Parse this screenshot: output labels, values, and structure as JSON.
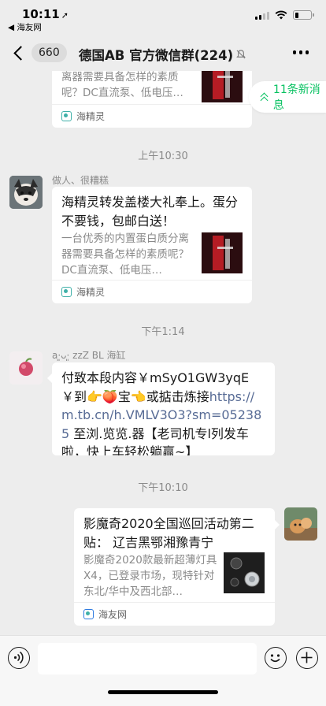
{
  "status_bar": {
    "time": "10:11",
    "back_app": "◀ 海友网"
  },
  "nav": {
    "unread_count": "660",
    "title": "德国AB  官方微信群(224)"
  },
  "new_messages": "11条新消息",
  "messages": [
    {
      "type": "card",
      "title": "",
      "desc": "离器需要具备怎样的素质呢？DC直流泵、低电压…",
      "source": "海精灵"
    },
    {
      "type": "timestamp",
      "text": "上午10:30"
    },
    {
      "type": "card",
      "sender": "做人、很糟糕",
      "title": "海精灵转发盖楼大礼奉上。蛋分不要钱，包邮白送！",
      "desc": "一台优秀的内置蛋白质分离器需要具备怎样的素质呢？DC直流泵、低电压…",
      "source": "海精灵"
    },
    {
      "type": "timestamp",
      "text": "下午1:14"
    },
    {
      "type": "text",
      "sender": "a·͈ᴗ·͈ zzZ BL 海缸",
      "text_part1": "付致本段内容￥mSyO1GW3yqE￥到👉🍑宝👈或掂击炼接",
      "link": "https://m.tb.cn/h.VMLV3O3?sm=052385",
      "text_part2": " 至浏.览览.器【老司机专l列发车啦，快上车轻松躺赢~】"
    },
    {
      "type": "timestamp",
      "text": "下午10:10"
    },
    {
      "type": "card",
      "title": "影魔奇2020全国巡回活动第二贴：  辽吉黑鄂湘豫青宁",
      "desc": "影魔奇2020款最新超薄灯具X4，已登录市场，现特针对东北/华中及西北部…",
      "source": "海友网"
    }
  ],
  "colors": {
    "accent": "#07c160",
    "link": "#576b95",
    "background": "#ededed"
  },
  "icons": [
    "location-arrow-icon",
    "signal-icon",
    "wifi-icon",
    "battery-icon",
    "back-chevron-icon",
    "mute-icon",
    "more-icon",
    "double-chevron-up-icon",
    "voice-icon",
    "emoji-icon",
    "plus-icon"
  ]
}
